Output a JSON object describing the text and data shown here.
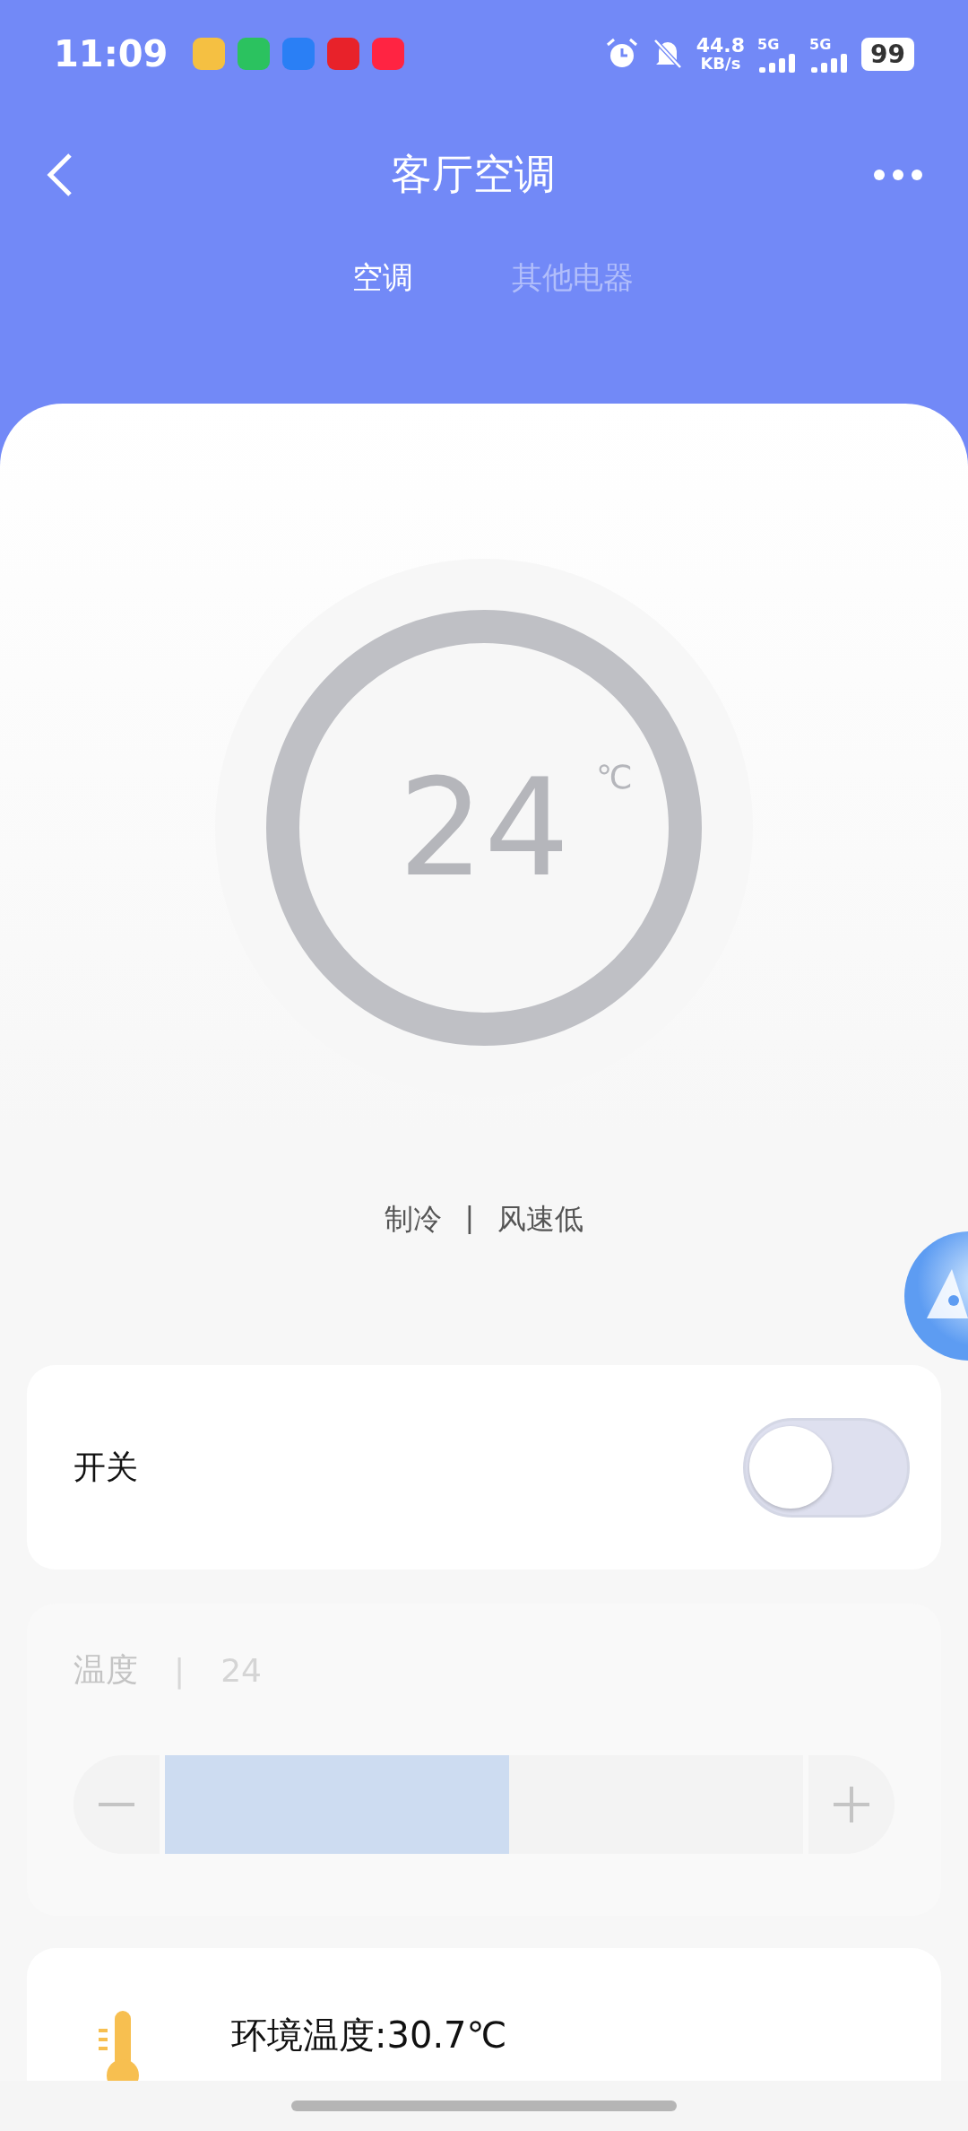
{
  "status_bar": {
    "time": "11:09",
    "speed_value": "44.8",
    "speed_unit": "KB/s",
    "sims": [
      "5G",
      "5G"
    ],
    "battery": "99"
  },
  "header": {
    "title": "客厅空调"
  },
  "tabs": [
    {
      "label": "空调",
      "selected": true
    },
    {
      "label": "其他电器",
      "selected": false
    }
  ],
  "dial": {
    "temperature": "24",
    "unit": "℃"
  },
  "mode": {
    "mode": "制冷",
    "separator": "|",
    "fan": "风速低"
  },
  "power": {
    "label": "开关",
    "on": false
  },
  "temperature": {
    "label": "温度",
    "separator": "|",
    "value": "24",
    "disabled": true,
    "level": 0.54
  },
  "environment": {
    "text": "环境温度:30.7℃"
  }
}
